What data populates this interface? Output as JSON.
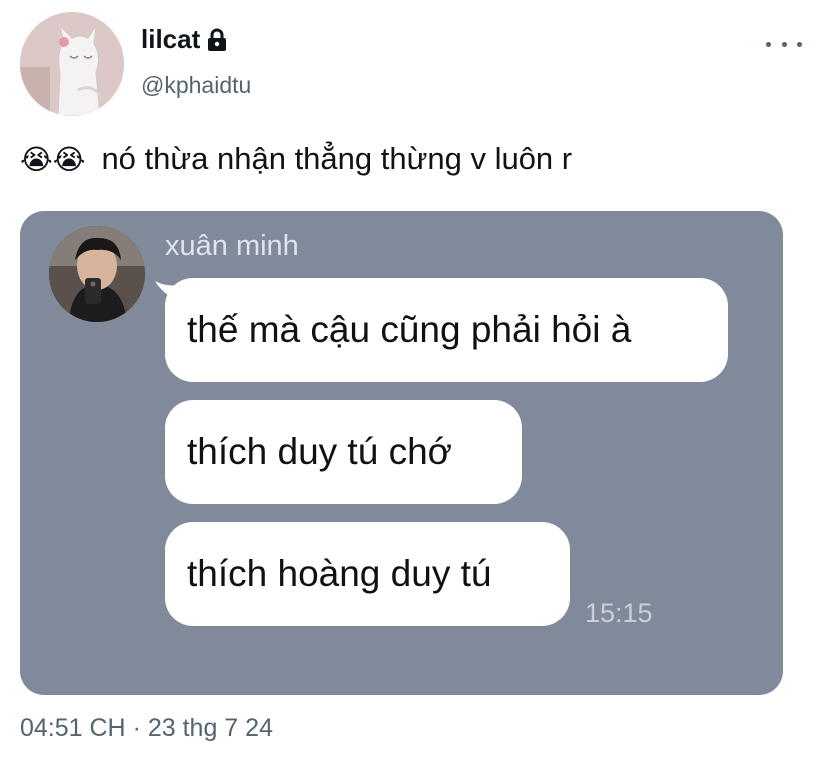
{
  "author": {
    "display_name": "lilcat",
    "handle": "@kphaidtu"
  },
  "icons": {
    "lock": "lock-icon",
    "more": "more-options-icon"
  },
  "tweet": {
    "emojis": "😭😭",
    "text": "nó thừa nhận thẳng thừng v luôn r"
  },
  "chat_screenshot": {
    "sender_name": "xuân minh",
    "messages": [
      "thế mà cậu cũng phải hỏi à",
      "thích duy tú chớ",
      "thích hoàng duy tú"
    ],
    "time": "15:15",
    "background_color": "#818a9b"
  },
  "timestamp": {
    "time": "04:51 CH",
    "separator": "·",
    "date": "23 thg 7 24"
  }
}
